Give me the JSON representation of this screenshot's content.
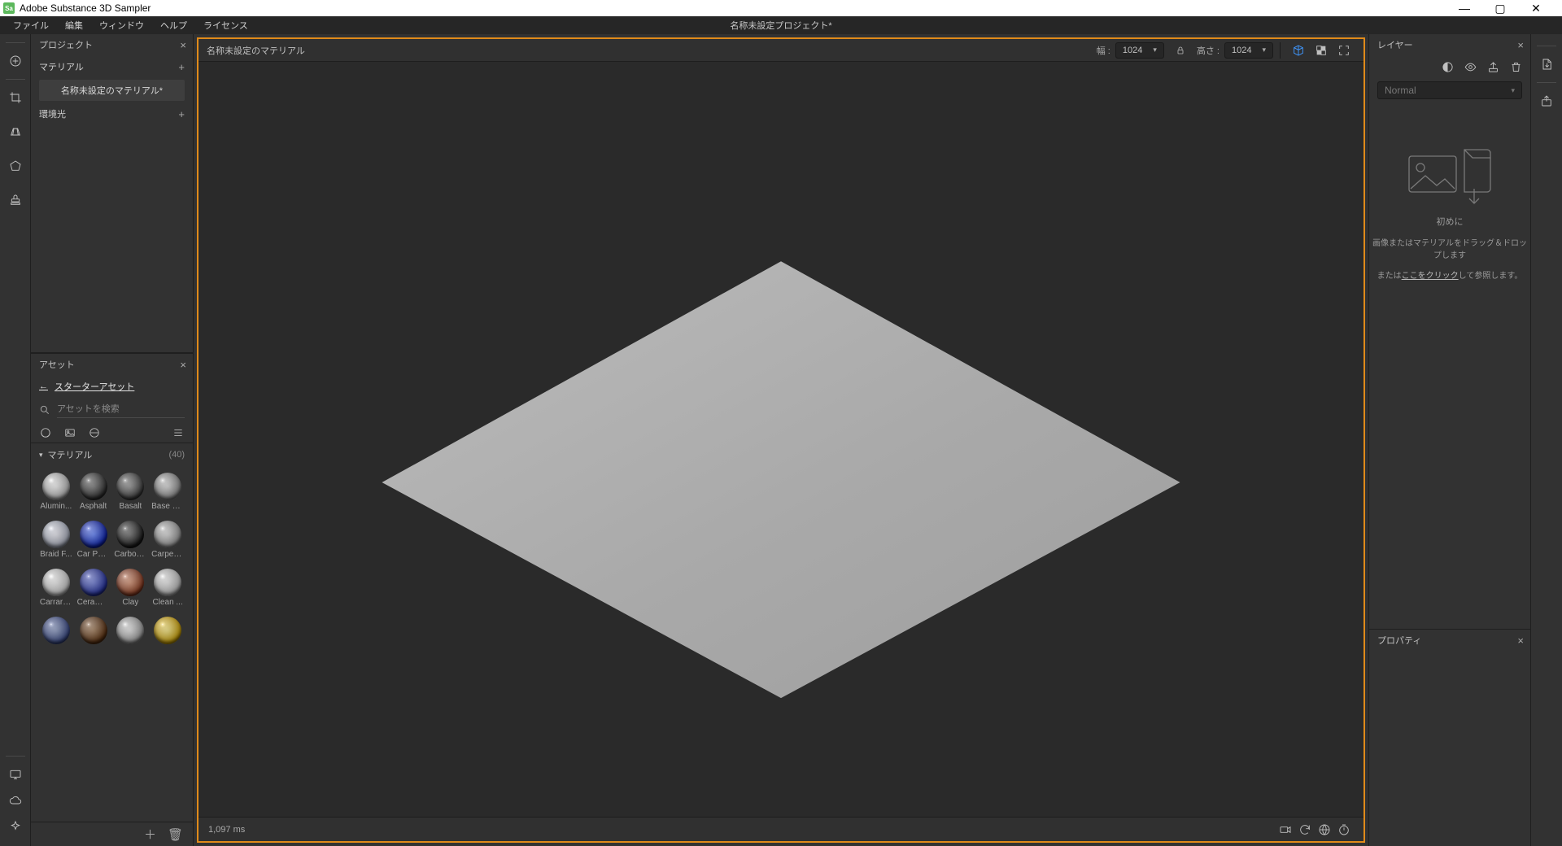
{
  "os_title": "Adobe Substance 3D Sampler",
  "app_icon_letters": "Sa",
  "menu": {
    "items": [
      "ファイル",
      "編集",
      "ウィンドウ",
      "ヘルプ",
      "ライセンス"
    ],
    "center": "名称未設定プロジェクト*"
  },
  "project_panel": {
    "title": "プロジェクト",
    "material_section": "マテリアル",
    "material_item": "名称未設定のマテリアル*",
    "env_section": "環境光"
  },
  "assets_panel": {
    "title": "アセット",
    "back_label": "スターターアセット",
    "search_placeholder": "アセットを検索",
    "group_label": "マテリアル",
    "group_count": "(40)",
    "items": [
      {
        "name": "Alumin...",
        "c1": "#f2f2f2",
        "c2": "#bcbcbc",
        "c3": "#454545"
      },
      {
        "name": "Asphalt",
        "c1": "#5a5a5a",
        "c2": "#2e2e2e",
        "c3": "#0c0c0c"
      },
      {
        "name": "Basalt",
        "c1": "#7a7a7a",
        "c2": "#3a3a3a",
        "c3": "#151515"
      },
      {
        "name": "Base M...",
        "c1": "#cfcfcf",
        "c2": "#8a8a8a",
        "c3": "#3a3a3a"
      },
      {
        "name": "Braid F...",
        "c1": "#e4e4ef",
        "c2": "#b0b6c6",
        "c3": "#3a3a3a"
      },
      {
        "name": "Car Paint",
        "c1": "#3a64ff",
        "c2": "#0b1fb0",
        "c3": "#010326"
      },
      {
        "name": "Carbon ...",
        "c1": "#4a4a4a",
        "c2": "#151515",
        "c3": "#000000"
      },
      {
        "name": "Carpet ...",
        "c1": "#cfcfcf",
        "c2": "#9a9a9a",
        "c3": "#3a3a3a"
      },
      {
        "name": "Carrara...",
        "c1": "#f0f0f0",
        "c2": "#d4d4d4",
        "c3": "#8a8a8a"
      },
      {
        "name": "Cerami...",
        "c1": "#4d5fd1",
        "c2": "#2430a0",
        "c3": "#0c1144"
      },
      {
        "name": "Clay",
        "c1": "#d07a52",
        "c2": "#8a3a20",
        "c3": "#3a120a"
      },
      {
        "name": "Clean ...",
        "c1": "#e8e8e8",
        "c2": "#c4c4c4",
        "c3": "#6a6a6a"
      },
      {
        "name": "",
        "c1": "#6f82b5",
        "c2": "#3a4a8a",
        "c3": "#1a2244"
      },
      {
        "name": "",
        "c1": "#8a5a2e",
        "c2": "#5a3010",
        "c3": "#201004"
      },
      {
        "name": "",
        "c1": "#e0e0e0",
        "c2": "#a0a0a0",
        "c3": "#444444"
      },
      {
        "name": "",
        "c1": "#f5e05a",
        "c2": "#d4a500",
        "c3": "#5a3a00"
      }
    ]
  },
  "viewport": {
    "tab_title": "名称未設定のマテリアル",
    "width_label": "幅 :",
    "width_value": "1024",
    "height_label": "高さ :",
    "height_value": "1024",
    "render_time": "1,097 ms"
  },
  "layers_panel": {
    "title": "レイヤー",
    "blend_mode": "Normal",
    "drop_line1": "初めに",
    "drop_line2_pre": "画像またはマテリアルをドラッグ＆ドロップします",
    "drop_line3_pre": "または",
    "drop_line3_link": "ここをクリック",
    "drop_line3_post": "して参照します。"
  },
  "props_panel": {
    "title": "プロパティ"
  }
}
